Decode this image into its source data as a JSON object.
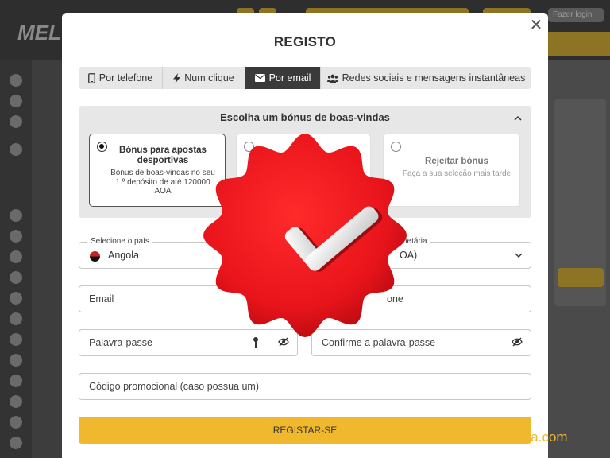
{
  "background": {
    "logo_text": "MEL",
    "top_right_label": "Fazer login"
  },
  "modal": {
    "title": "REGISTO",
    "close_symbol": "✕",
    "tabs": [
      {
        "label": "Por telefone",
        "icon": "phone-icon",
        "active": false
      },
      {
        "label": "Num clique",
        "icon": "lightning-icon",
        "active": false
      },
      {
        "label": "Por email",
        "icon": "envelope-icon",
        "active": true
      },
      {
        "label": "Redes sociais e mensagens instantâneas",
        "icon": "users-icon",
        "active": false
      }
    ],
    "bonus": {
      "heading": "Escolha um bónus de boas-vindas",
      "cards": [
        {
          "title": "Bónus para apostas desportivas",
          "description": "Bónus de boas-vindas no seu 1.º depósito de até 120000 AOA",
          "selected": true
        },
        {
          "title": "",
          "description": "",
          "selected": false
        },
        {
          "title": "Rejeitar bónus",
          "description": "Faça a sua seleção mais tarde",
          "selected": false
        }
      ]
    },
    "fields": {
      "country_label": "Selecione o país",
      "country_value": "Angola",
      "currency_label_partial": "netária",
      "currency_value_partial": "OA)",
      "email_placeholder": "Email",
      "phone_placeholder_partial": "one",
      "password_placeholder": "Palavra-passe",
      "confirm_password_placeholder": "Confirme a palavra-passe",
      "promo_placeholder": "Código promocional (caso possua um)"
    },
    "submit_label": "REGISTAR-SE"
  },
  "overlay": {
    "badge_icon": "checkmark-seal-icon",
    "badge_color": "#e8141b",
    "watermark": "melbet-angola.com"
  },
  "colors": {
    "accent": "#f0b92d",
    "active_tab": "#3a3a3a"
  }
}
